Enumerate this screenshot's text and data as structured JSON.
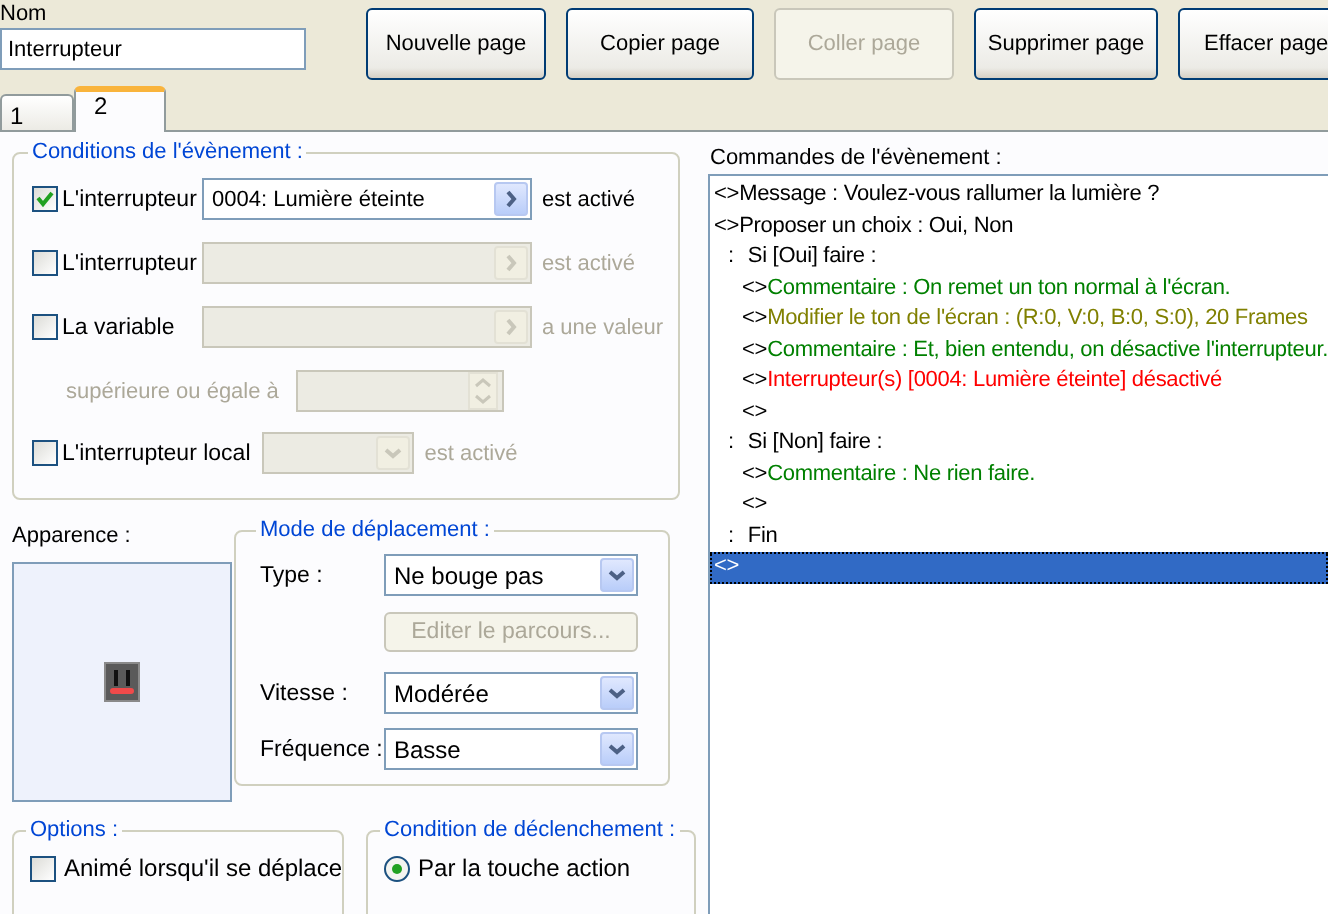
{
  "name_field": {
    "label": "Nom",
    "value": "Interrupteur"
  },
  "page_buttons": [
    {
      "label": "Nouvelle page",
      "disabled": false
    },
    {
      "label": "Copier page",
      "disabled": false
    },
    {
      "label": "Coller page",
      "disabled": true
    },
    {
      "label": "Supprimer page",
      "disabled": false
    },
    {
      "label": "Effacer page",
      "disabled": false
    }
  ],
  "tabs": [
    {
      "label": "1",
      "selected": false
    },
    {
      "label": "2",
      "selected": true
    }
  ],
  "conditions": {
    "title": "Conditions de l'évènement :",
    "rows": [
      {
        "kind": "switch",
        "label": "L'interrupteur",
        "checked": true,
        "value": "0004: Lumière éteinte",
        "suffix": "est activé"
      },
      {
        "kind": "switch",
        "label": "L'interrupteur",
        "checked": false,
        "suffix": "est activé"
      },
      {
        "kind": "variable",
        "label": "La variable",
        "checked": false,
        "suffix": "a une valeur"
      },
      {
        "kind": "threshold",
        "label": "supérieure ou égale à",
        "disabled": true
      },
      {
        "kind": "local",
        "label": "L'interrupteur local",
        "checked": false,
        "suffix": "est activé"
      }
    ]
  },
  "appearance": {
    "label": "Apparence :"
  },
  "movement": {
    "title": "Mode de déplacement :",
    "fields": [
      {
        "kind": "select",
        "label": "Type :",
        "value": "Ne bouge pas"
      },
      {
        "kind": "button",
        "label": "Editer le parcours...",
        "disabled": true
      },
      {
        "kind": "select",
        "label": "Vitesse :",
        "value": "Modérée"
      },
      {
        "kind": "select",
        "label": "Fréquence :",
        "value": "Basse"
      }
    ]
  },
  "options": {
    "title": "Options :",
    "items": [
      {
        "label": "Animé lorsqu'il se déplace",
        "checked": false
      }
    ]
  },
  "trigger": {
    "title": "Condition de déclenchement :",
    "items": [
      {
        "label": "Par la touche action",
        "selected": true
      }
    ]
  },
  "commands": {
    "label": "Commandes de l'évènement :",
    "lines": [
      {
        "kind": "plain",
        "marker": "<>",
        "text": "Message : Voulez-vous rallumer la lumière ?",
        "selected": false
      },
      {
        "kind": "plain",
        "marker": "<>",
        "text": "Proposer un choix : Oui, Non",
        "selected": false,
        "children": [
          {
            "kind": "branch",
            "marker": ":",
            "text": "Si [Oui] faire :",
            "selected": false,
            "children": [
              {
                "kind": "comment",
                "marker": "<>",
                "text": "Commentaire : On remet un ton normal à l'écran.",
                "selected": false
              },
              {
                "kind": "screen",
                "marker": "<>",
                "text": "Modifier le ton de l'écran : (R:0, V:0, B:0, S:0), 20 Frames",
                "selected": false
              },
              {
                "kind": "comment",
                "marker": "<>",
                "text": "Commentaire : Et, bien entendu, on désactive l'interrupteur.",
                "selected": false
              },
              {
                "kind": "switch",
                "marker": "<>",
                "text": "Interrupteur(s) [0004: Lumière éteinte] désactivé",
                "selected": false
              },
              {
                "kind": "plain",
                "marker": "<>",
                "selected": false
              }
            ]
          },
          {
            "kind": "branch",
            "marker": ":",
            "text": "Si [Non] faire :",
            "selected": false,
            "children": [
              {
                "kind": "comment",
                "marker": "<>",
                "text": "Commentaire : Ne rien faire.",
                "selected": false
              },
              {
                "kind": "plain",
                "marker": "<>",
                "selected": false
              }
            ]
          },
          {
            "kind": "branch",
            "marker": ":",
            "text": "Fin",
            "selected": false
          }
        ]
      },
      {
        "kind": "plain",
        "marker": "<>",
        "selected": true
      }
    ]
  }
}
